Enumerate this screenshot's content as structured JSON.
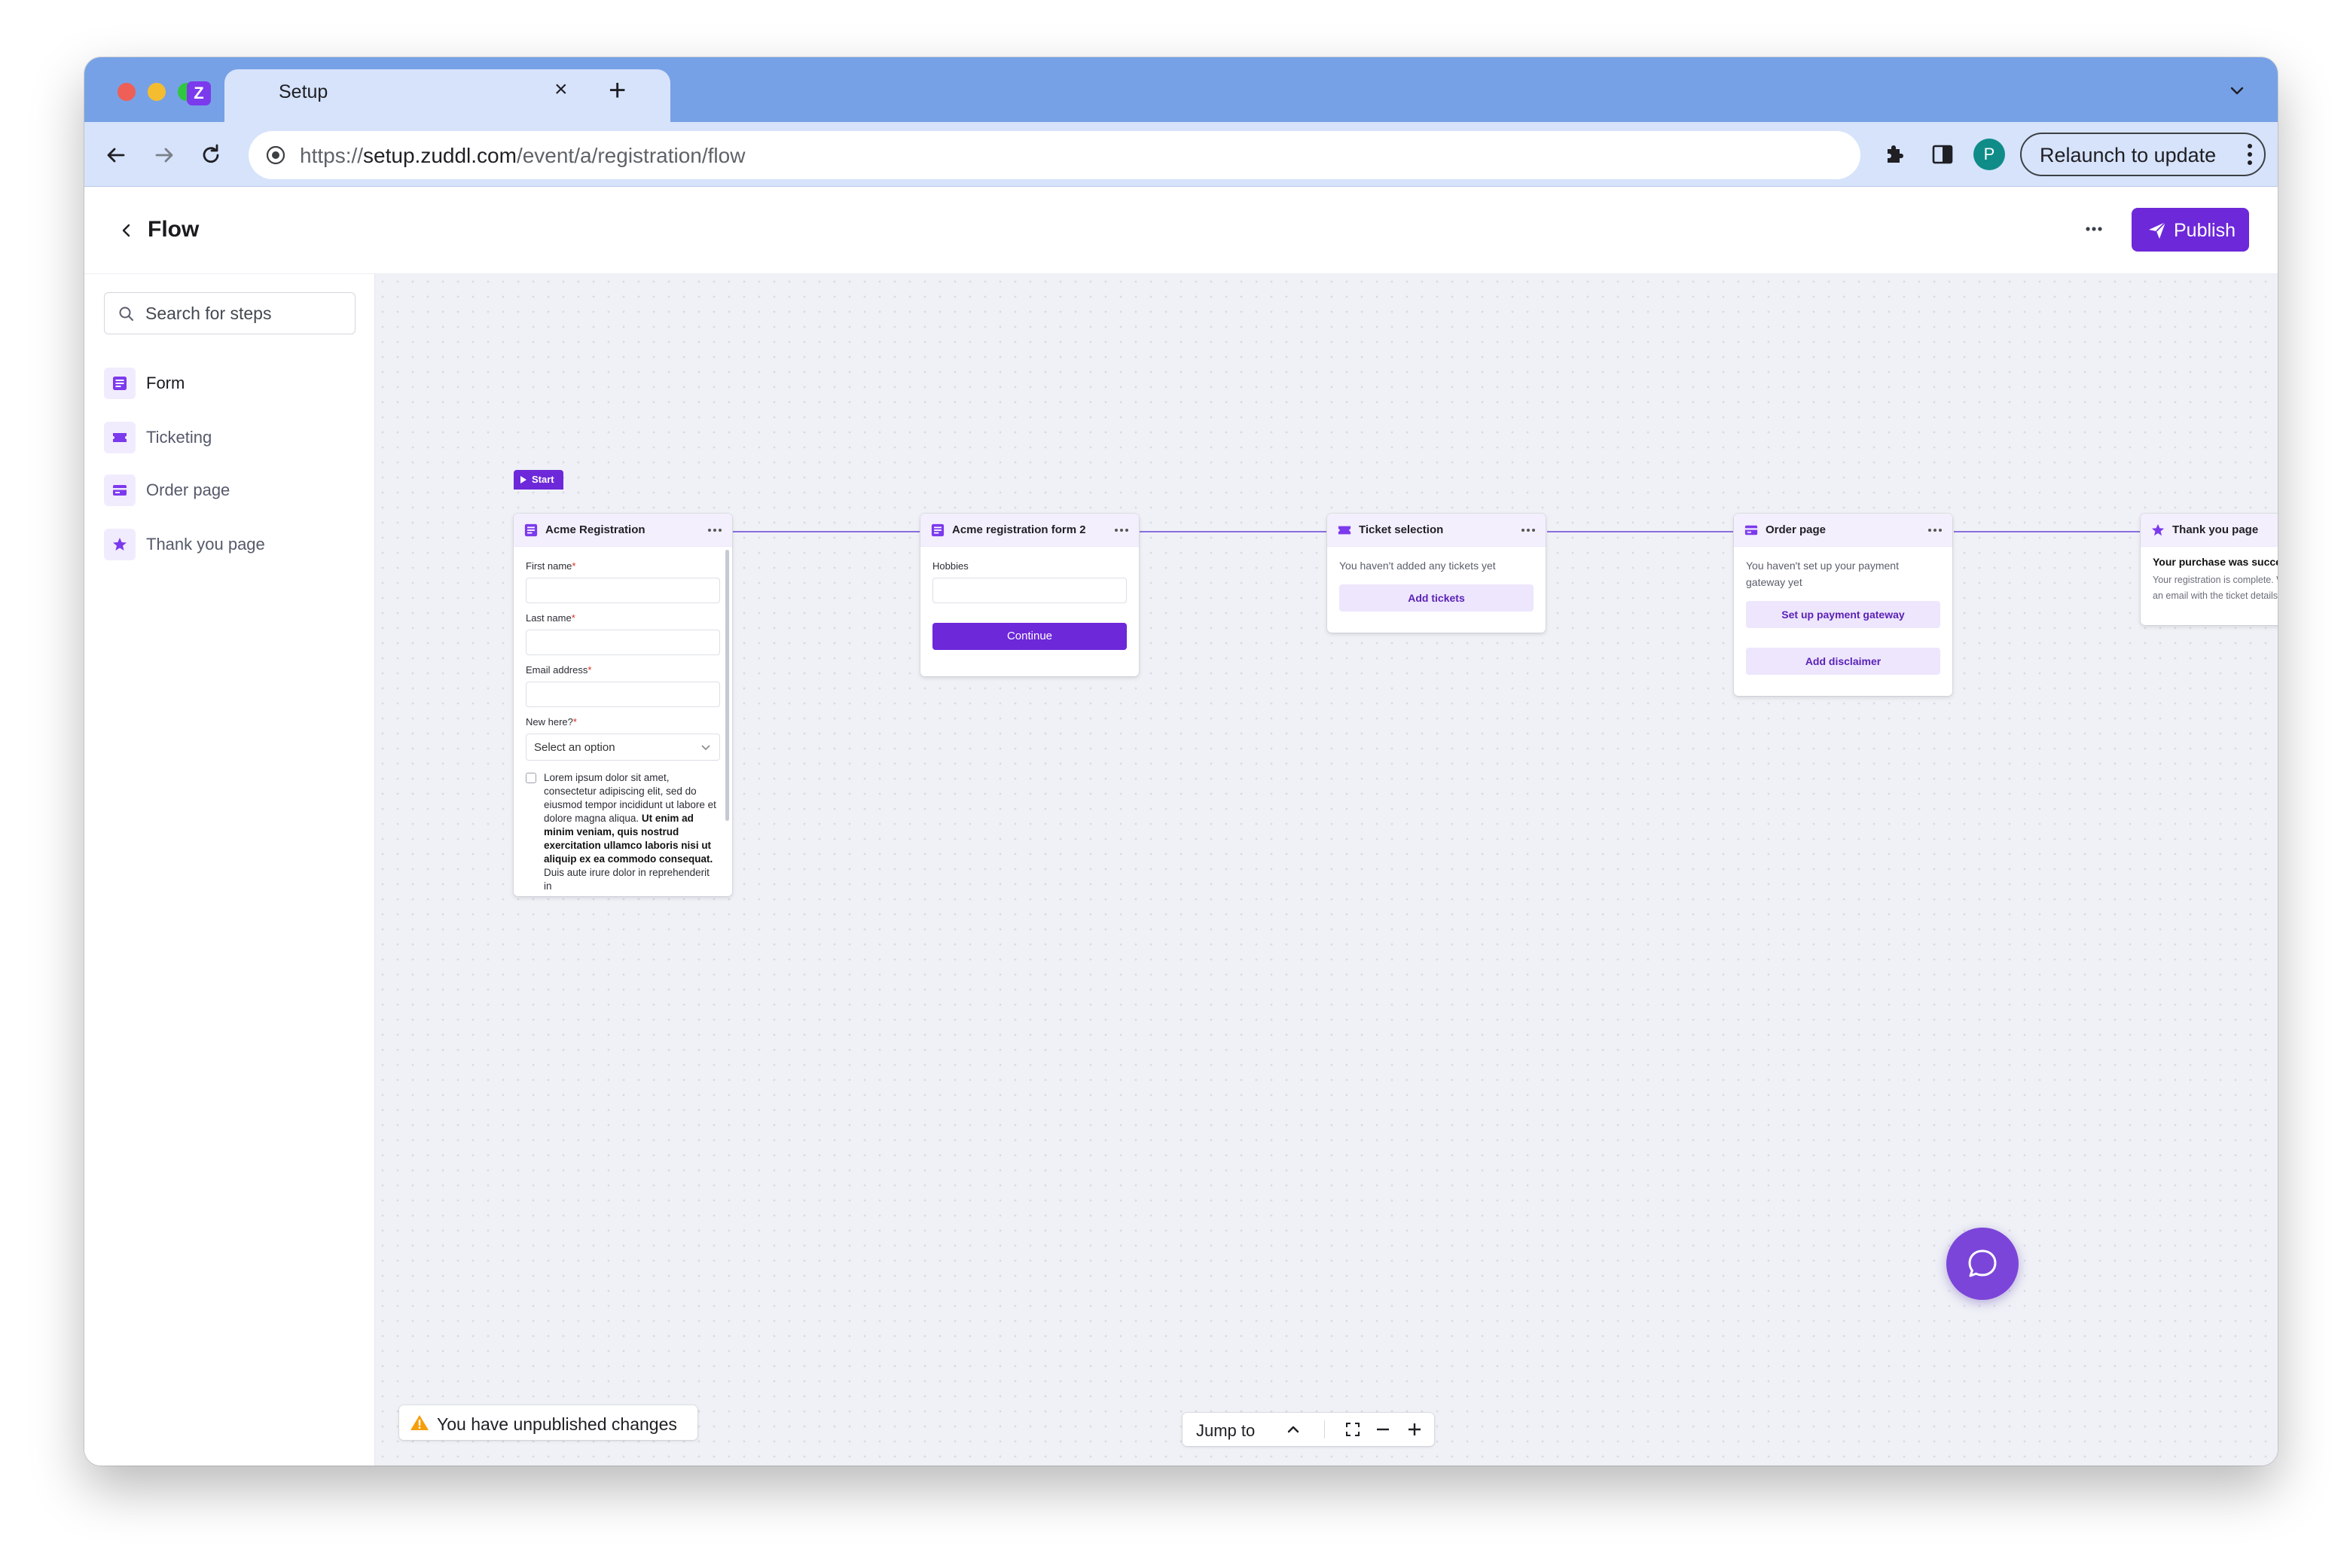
{
  "browser": {
    "tab_title": "Setup",
    "tab_close": "×",
    "tab_new": "+",
    "url_scheme": "https://",
    "url_host": "setup.zuddl.com",
    "url_path": "/event/a/registration/flow",
    "profile_initial": "P",
    "relaunch_label": "Relaunch to update",
    "favicon_letter": "Z"
  },
  "header": {
    "title": "Flow",
    "publish_label": "Publish"
  },
  "sidebar": {
    "search_placeholder": "Search for steps",
    "items": [
      {
        "label": "Form",
        "icon": "form-icon"
      },
      {
        "label": "Ticketing",
        "icon": "ticket-icon"
      },
      {
        "label": "Order page",
        "icon": "card-icon"
      },
      {
        "label": "Thank you page",
        "icon": "star-icon"
      }
    ]
  },
  "canvas": {
    "start_label": "Start",
    "nodes": {
      "registration": {
        "title": "Acme Registration",
        "fields": [
          {
            "label": "First name",
            "required": "*"
          },
          {
            "label": "Last name",
            "required": "*"
          },
          {
            "label": "Email address",
            "required": "*"
          },
          {
            "label": "New here?",
            "required": "*"
          }
        ],
        "select_placeholder": "Select an option",
        "consent_text_1": "Lorem ipsum dolor sit amet, consectetur adipiscing elit, sed do eiusmod tempor incididunt ut labore et dolore magna aliqua.",
        "consent_text_bold": "Ut enim ad minim veniam, quis nostrud exercitation ullamco laboris nisi ut aliquip ex ea commodo consequat.",
        "consent_text_2": "Duis aute irure dolor in reprehenderit in"
      },
      "form2": {
        "title": "Acme registration form 2",
        "field_label": "Hobbies",
        "continue_label": "Continue"
      },
      "tickets": {
        "title": "Ticket selection",
        "empty_text": "You haven't added any tickets yet",
        "add_label": "Add tickets"
      },
      "order": {
        "title": "Order page",
        "empty_text": "You haven't set up your payment gateway yet",
        "gateway_label": "Set up payment gateway",
        "disclaimer_label": "Add disclaimer"
      },
      "thankyou": {
        "title": "Thank you page",
        "heading": "Your purchase was successful!",
        "body": "Your registration is complete. We've sent you an email with the ticket details."
      }
    },
    "unpublished_text": "You have unpublished changes",
    "jump_label": "Jump to"
  },
  "colors": {
    "accent": "#6d28d9",
    "tabbar": "#77a1e6",
    "toolbar": "#d6e3fb",
    "connector": "#8a6ee0",
    "warning": "#f59e0b"
  }
}
